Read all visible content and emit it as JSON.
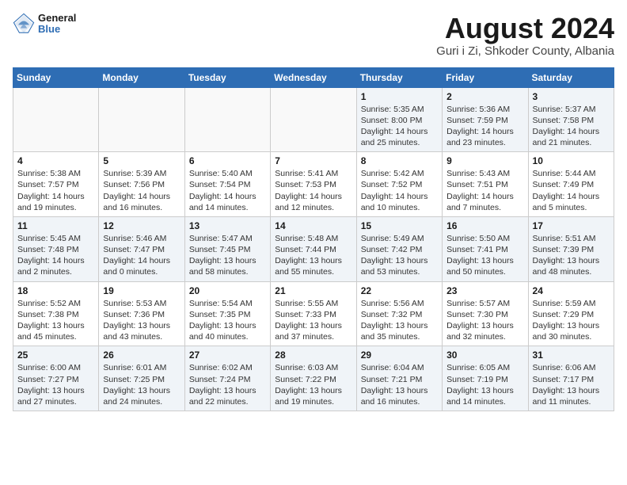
{
  "header": {
    "title": "August 2024",
    "subtitle": "Guri i Zi, Shkoder County, Albania",
    "logo_general": "General",
    "logo_blue": "Blue"
  },
  "weekdays": [
    "Sunday",
    "Monday",
    "Tuesday",
    "Wednesday",
    "Thursday",
    "Friday",
    "Saturday"
  ],
  "weeks": [
    [
      {
        "day": "",
        "info": ""
      },
      {
        "day": "",
        "info": ""
      },
      {
        "day": "",
        "info": ""
      },
      {
        "day": "",
        "info": ""
      },
      {
        "day": "1",
        "info": "Sunrise: 5:35 AM\nSunset: 8:00 PM\nDaylight: 14 hours\nand 25 minutes."
      },
      {
        "day": "2",
        "info": "Sunrise: 5:36 AM\nSunset: 7:59 PM\nDaylight: 14 hours\nand 23 minutes."
      },
      {
        "day": "3",
        "info": "Sunrise: 5:37 AM\nSunset: 7:58 PM\nDaylight: 14 hours\nand 21 minutes."
      }
    ],
    [
      {
        "day": "4",
        "info": "Sunrise: 5:38 AM\nSunset: 7:57 PM\nDaylight: 14 hours\nand 19 minutes."
      },
      {
        "day": "5",
        "info": "Sunrise: 5:39 AM\nSunset: 7:56 PM\nDaylight: 14 hours\nand 16 minutes."
      },
      {
        "day": "6",
        "info": "Sunrise: 5:40 AM\nSunset: 7:54 PM\nDaylight: 14 hours\nand 14 minutes."
      },
      {
        "day": "7",
        "info": "Sunrise: 5:41 AM\nSunset: 7:53 PM\nDaylight: 14 hours\nand 12 minutes."
      },
      {
        "day": "8",
        "info": "Sunrise: 5:42 AM\nSunset: 7:52 PM\nDaylight: 14 hours\nand 10 minutes."
      },
      {
        "day": "9",
        "info": "Sunrise: 5:43 AM\nSunset: 7:51 PM\nDaylight: 14 hours\nand 7 minutes."
      },
      {
        "day": "10",
        "info": "Sunrise: 5:44 AM\nSunset: 7:49 PM\nDaylight: 14 hours\nand 5 minutes."
      }
    ],
    [
      {
        "day": "11",
        "info": "Sunrise: 5:45 AM\nSunset: 7:48 PM\nDaylight: 14 hours\nand 2 minutes."
      },
      {
        "day": "12",
        "info": "Sunrise: 5:46 AM\nSunset: 7:47 PM\nDaylight: 14 hours\nand 0 minutes."
      },
      {
        "day": "13",
        "info": "Sunrise: 5:47 AM\nSunset: 7:45 PM\nDaylight: 13 hours\nand 58 minutes."
      },
      {
        "day": "14",
        "info": "Sunrise: 5:48 AM\nSunset: 7:44 PM\nDaylight: 13 hours\nand 55 minutes."
      },
      {
        "day": "15",
        "info": "Sunrise: 5:49 AM\nSunset: 7:42 PM\nDaylight: 13 hours\nand 53 minutes."
      },
      {
        "day": "16",
        "info": "Sunrise: 5:50 AM\nSunset: 7:41 PM\nDaylight: 13 hours\nand 50 minutes."
      },
      {
        "day": "17",
        "info": "Sunrise: 5:51 AM\nSunset: 7:39 PM\nDaylight: 13 hours\nand 48 minutes."
      }
    ],
    [
      {
        "day": "18",
        "info": "Sunrise: 5:52 AM\nSunset: 7:38 PM\nDaylight: 13 hours\nand 45 minutes."
      },
      {
        "day": "19",
        "info": "Sunrise: 5:53 AM\nSunset: 7:36 PM\nDaylight: 13 hours\nand 43 minutes."
      },
      {
        "day": "20",
        "info": "Sunrise: 5:54 AM\nSunset: 7:35 PM\nDaylight: 13 hours\nand 40 minutes."
      },
      {
        "day": "21",
        "info": "Sunrise: 5:55 AM\nSunset: 7:33 PM\nDaylight: 13 hours\nand 37 minutes."
      },
      {
        "day": "22",
        "info": "Sunrise: 5:56 AM\nSunset: 7:32 PM\nDaylight: 13 hours\nand 35 minutes."
      },
      {
        "day": "23",
        "info": "Sunrise: 5:57 AM\nSunset: 7:30 PM\nDaylight: 13 hours\nand 32 minutes."
      },
      {
        "day": "24",
        "info": "Sunrise: 5:59 AM\nSunset: 7:29 PM\nDaylight: 13 hours\nand 30 minutes."
      }
    ],
    [
      {
        "day": "25",
        "info": "Sunrise: 6:00 AM\nSunset: 7:27 PM\nDaylight: 13 hours\nand 27 minutes."
      },
      {
        "day": "26",
        "info": "Sunrise: 6:01 AM\nSunset: 7:25 PM\nDaylight: 13 hours\nand 24 minutes."
      },
      {
        "day": "27",
        "info": "Sunrise: 6:02 AM\nSunset: 7:24 PM\nDaylight: 13 hours\nand 22 minutes."
      },
      {
        "day": "28",
        "info": "Sunrise: 6:03 AM\nSunset: 7:22 PM\nDaylight: 13 hours\nand 19 minutes."
      },
      {
        "day": "29",
        "info": "Sunrise: 6:04 AM\nSunset: 7:21 PM\nDaylight: 13 hours\nand 16 minutes."
      },
      {
        "day": "30",
        "info": "Sunrise: 6:05 AM\nSunset: 7:19 PM\nDaylight: 13 hours\nand 14 minutes."
      },
      {
        "day": "31",
        "info": "Sunrise: 6:06 AM\nSunset: 7:17 PM\nDaylight: 13 hours\nand 11 minutes."
      }
    ]
  ]
}
